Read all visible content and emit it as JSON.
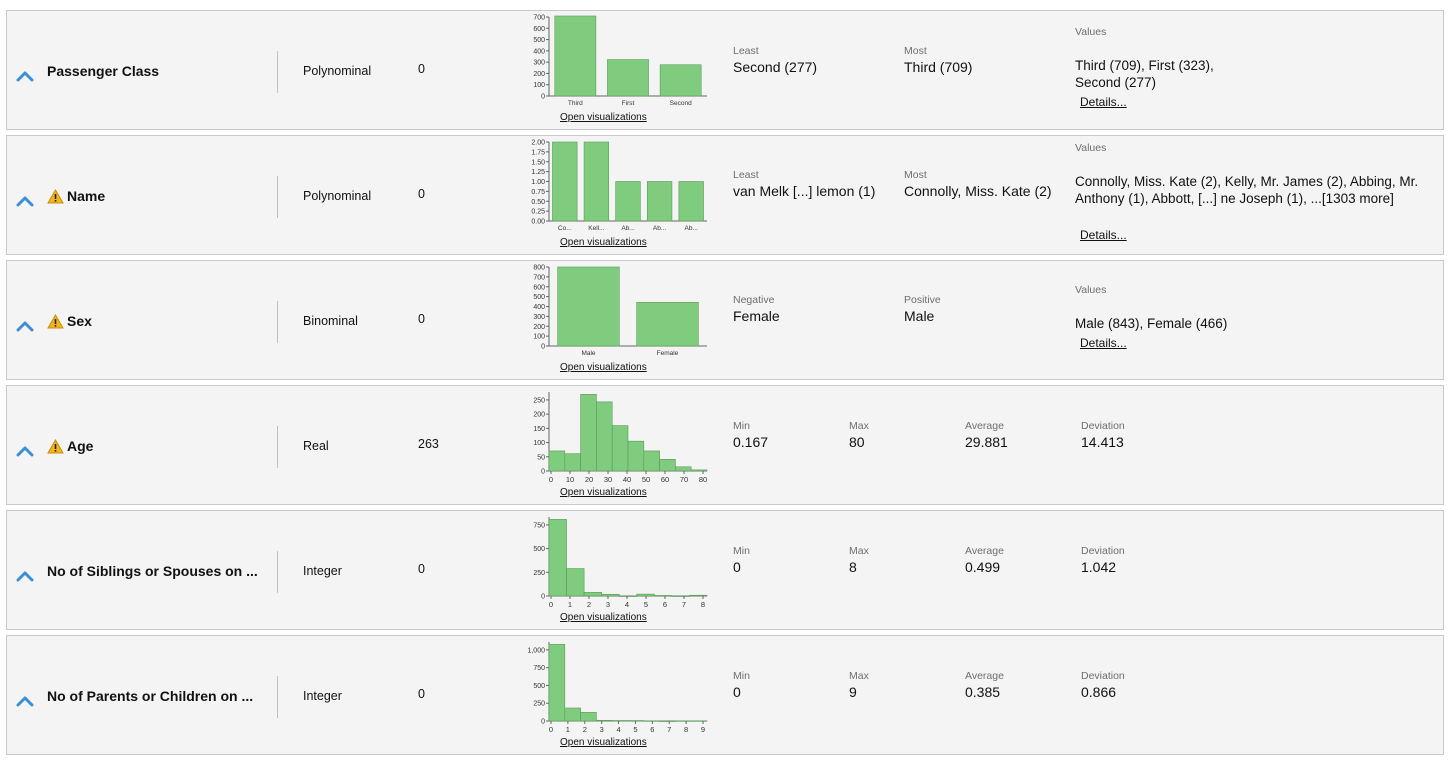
{
  "attributes": [
    {
      "name": "Passenger Class",
      "warning": false,
      "type": "Polynominal",
      "missing": "0",
      "open_visualizations": "Open visualizations",
      "stats": [
        {
          "label": "Least",
          "value": "Second (277)"
        },
        {
          "label": "Most",
          "value": "Third (709)"
        }
      ],
      "values_label": "Values",
      "values_text": "Third (709), First (323), Second (277)",
      "details": "Details...",
      "chart_data": {
        "type": "bar",
        "categories": [
          "Third",
          "First",
          "Second"
        ],
        "values": [
          709,
          323,
          277
        ],
        "ylim": [
          0,
          700
        ],
        "yticks": [
          "700",
          "600",
          "500",
          "400",
          "300",
          "200",
          "100",
          "0"
        ]
      }
    },
    {
      "name": "Name",
      "warning": true,
      "type": "Polynominal",
      "missing": "0",
      "open_visualizations": "Open visualizations",
      "stats": [
        {
          "label": "Least",
          "value": "van Melk [...] lemon (1)"
        },
        {
          "label": "Most",
          "value": "Connolly, Miss. Kate (2)"
        }
      ],
      "values_label": "Values",
      "values_text": "Connolly, Miss. Kate (2), Kelly, Mr. James (2), Abbing, Mr. Anthony (1), Abbott, [...] ne Joseph (1), ...[1303 more]",
      "details": "Details...",
      "chart_data": {
        "type": "bar",
        "categories": [
          "Co...",
          "Kell...",
          "Ab...",
          "Ab...",
          "Ab..."
        ],
        "values": [
          2,
          2,
          1,
          1,
          1
        ],
        "ylim": [
          0,
          2
        ],
        "yticks": [
          "2.00",
          "1.75",
          "1.50",
          "1.25",
          "1.00",
          "0.75",
          "0.50",
          "0.25",
          "0.00"
        ]
      }
    },
    {
      "name": "Sex",
      "warning": true,
      "type": "Binominal",
      "missing": "0",
      "open_visualizations": "Open visualizations",
      "stats": [
        {
          "label": "Negative",
          "value": "Female"
        },
        {
          "label": "Positive",
          "value": "Male"
        }
      ],
      "values_label": "Values",
      "values_text": "Male (843), Female (466)",
      "details": "Details...",
      "chart_data": {
        "type": "bar",
        "categories": [
          "Male",
          "Female"
        ],
        "values": [
          843,
          466
        ],
        "ylim": [
          0,
          843
        ],
        "yticks": [
          "800",
          "700",
          "600",
          "500",
          "400",
          "300",
          "200",
          "100",
          "0"
        ]
      }
    },
    {
      "name": "Age",
      "warning": true,
      "type": "Real",
      "missing": "263",
      "open_visualizations": "Open visualizations",
      "stats": [
        {
          "label": "Min",
          "value": "0.167"
        },
        {
          "label": "Max",
          "value": "80"
        },
        {
          "label": "Average",
          "value": "29.881"
        },
        {
          "label": "Deviation",
          "value": "14.413"
        }
      ],
      "chart_data": {
        "type": "bar",
        "bins": [
          72,
          62,
          275,
          248,
          163,
          107,
          72,
          42,
          15,
          4
        ],
        "xlim": [
          0,
          80
        ],
        "ylim": [
          0,
          275
        ],
        "xticks": [
          "0",
          "10",
          "20",
          "30",
          "40",
          "50",
          "60",
          "70",
          "80"
        ],
        "yticks": [
          "250",
          "200",
          "150",
          "100",
          "50",
          "0"
        ]
      }
    },
    {
      "name": "No of Siblings or Spouses on ...",
      "warning": false,
      "type": "Integer",
      "missing": "0",
      "open_visualizations": "Open visualizations",
      "stats": [
        {
          "label": "Min",
          "value": "0"
        },
        {
          "label": "Max",
          "value": "8"
        },
        {
          "label": "Average",
          "value": "0.499"
        },
        {
          "label": "Deviation",
          "value": "1.042"
        }
      ],
      "chart_data": {
        "type": "bar",
        "bins": [
          891,
          319,
          42,
          20,
          0,
          22,
          6,
          0,
          9
        ],
        "xlim": [
          0,
          8
        ],
        "ylim": [
          0,
          891
        ],
        "xticks": [
          "0",
          "1",
          "2",
          "3",
          "4",
          "5",
          "6",
          "7",
          "8"
        ],
        "yticks": [
          "750",
          "500",
          "250",
          "0"
        ]
      }
    },
    {
      "name": "No of Parents or Children on ...",
      "warning": false,
      "type": "Integer",
      "missing": "0",
      "open_visualizations": "Open visualizations",
      "stats": [
        {
          "label": "Min",
          "value": "0"
        },
        {
          "label": "Max",
          "value": "9"
        },
        {
          "label": "Average",
          "value": "0.385"
        },
        {
          "label": "Deviation",
          "value": "0.866"
        }
      ],
      "chart_data": {
        "type": "bar",
        "bins": [
          1002,
          170,
          113,
          8,
          6,
          6,
          2,
          0,
          2,
          2
        ],
        "xlim": [
          0,
          9
        ],
        "ylim": [
          0,
          1002
        ],
        "xticks": [
          "0",
          "1",
          "2",
          "3",
          "4",
          "5",
          "6",
          "7",
          "8",
          "9"
        ],
        "yticks": [
          "1,000",
          "750",
          "500",
          "250",
          "0"
        ]
      }
    }
  ],
  "colors": {
    "bar_fill": "#80cc7e",
    "bar_stroke": "#5a9a58",
    "chevron": "#3c8fd6",
    "warning": "#f2b51c"
  }
}
